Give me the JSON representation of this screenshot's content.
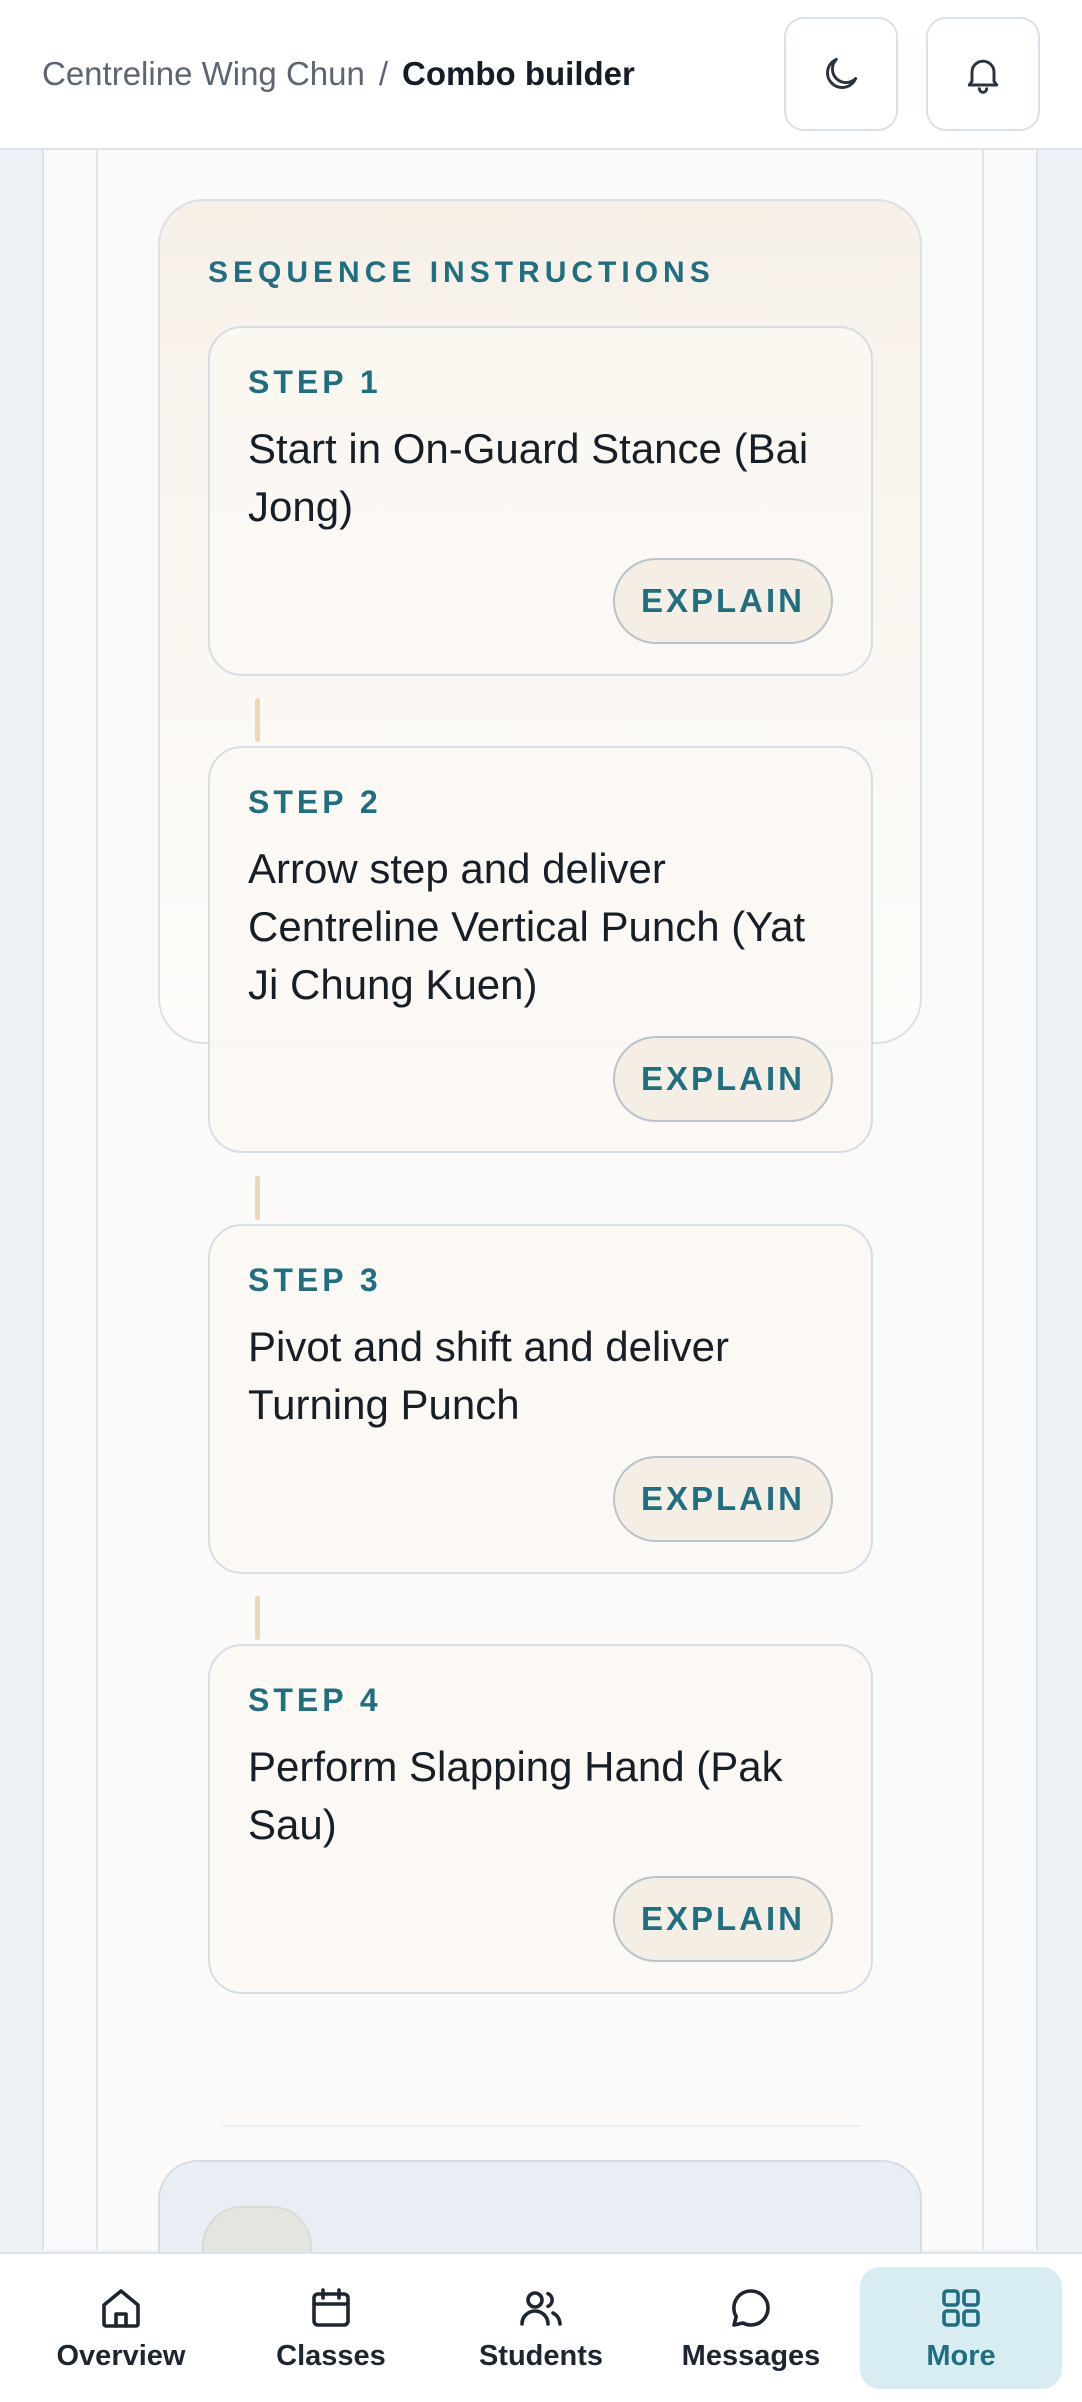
{
  "header": {
    "breadcrumb_root": "Centreline Wing Chun",
    "breadcrumb_separator": "/",
    "breadcrumb_current": "Combo builder",
    "theme_toggle_icon": "moon-icon",
    "notifications_icon": "bell-icon"
  },
  "sequence": {
    "title": "SEQUENCE INSTRUCTIONS",
    "steps": [
      {
        "label": "STEP 1",
        "text": "Start in On-Guard Stance (Bai Jong)",
        "button": "EXPLAIN"
      },
      {
        "label": "STEP 2",
        "text": "Arrow step and deliver Centreline Vertical Punch (Yat Ji Chung Kuen)",
        "button": "EXPLAIN"
      },
      {
        "label": "STEP 3",
        "text": "Pivot and shift and deliver Turning Punch",
        "button": "EXPLAIN"
      },
      {
        "label": "STEP 4",
        "text": "Perform Slapping Hand (Pak Sau)",
        "button": "EXPLAIN"
      }
    ]
  },
  "bottom_nav": {
    "items": [
      {
        "label": "Overview",
        "icon": "home-icon"
      },
      {
        "label": "Classes",
        "icon": "calendar-icon"
      },
      {
        "label": "Students",
        "icon": "users-icon"
      },
      {
        "label": "Messages",
        "icon": "chat-icon"
      },
      {
        "label": "More",
        "icon": "grid-icon",
        "active": true
      }
    ]
  },
  "colors": {
    "accent": "#1f6f80",
    "panel_bg": "#f6f0e7",
    "active_nav_bg": "#d8edf1"
  }
}
